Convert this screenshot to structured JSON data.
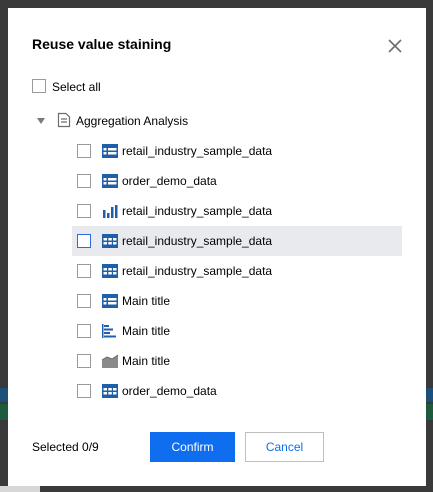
{
  "dialog": {
    "title": "Reuse value staining",
    "select_all_label": "Select all",
    "folder": {
      "label": "Aggregation Analysis",
      "icon": "document-icon",
      "expanded": true
    },
    "items": [
      {
        "label": "retail_industry_sample_data",
        "icon": "table-icon",
        "checked": false,
        "highlighted": false
      },
      {
        "label": "order_demo_data",
        "icon": "table-icon",
        "checked": false,
        "highlighted": false
      },
      {
        "label": "retail_industry_sample_data",
        "icon": "bar-chart-icon",
        "checked": false,
        "highlighted": false
      },
      {
        "label": "retail_industry_sample_data",
        "icon": "grid-table-icon",
        "checked": false,
        "highlighted": true
      },
      {
        "label": "retail_industry_sample_data",
        "icon": "grid-table-icon",
        "checked": false,
        "highlighted": false
      },
      {
        "label": "Main title",
        "icon": "table-icon",
        "checked": false,
        "highlighted": false
      },
      {
        "label": "Main title",
        "icon": "horizontal-bar-icon",
        "checked": false,
        "highlighted": false
      },
      {
        "label": "Main title",
        "icon": "area-chart-icon",
        "checked": false,
        "highlighted": false
      },
      {
        "label": "order_demo_data",
        "icon": "grid-table-icon",
        "checked": false,
        "highlighted": false
      }
    ],
    "selected_text": "Selected 0/9",
    "confirm_label": "Confirm",
    "cancel_label": "Cancel"
  },
  "colors": {
    "accent": "#0f6ef0",
    "icon_blue": "#1f5fa8",
    "icon_gray": "#8a8a8a",
    "highlight_row": "#e8eaee"
  }
}
